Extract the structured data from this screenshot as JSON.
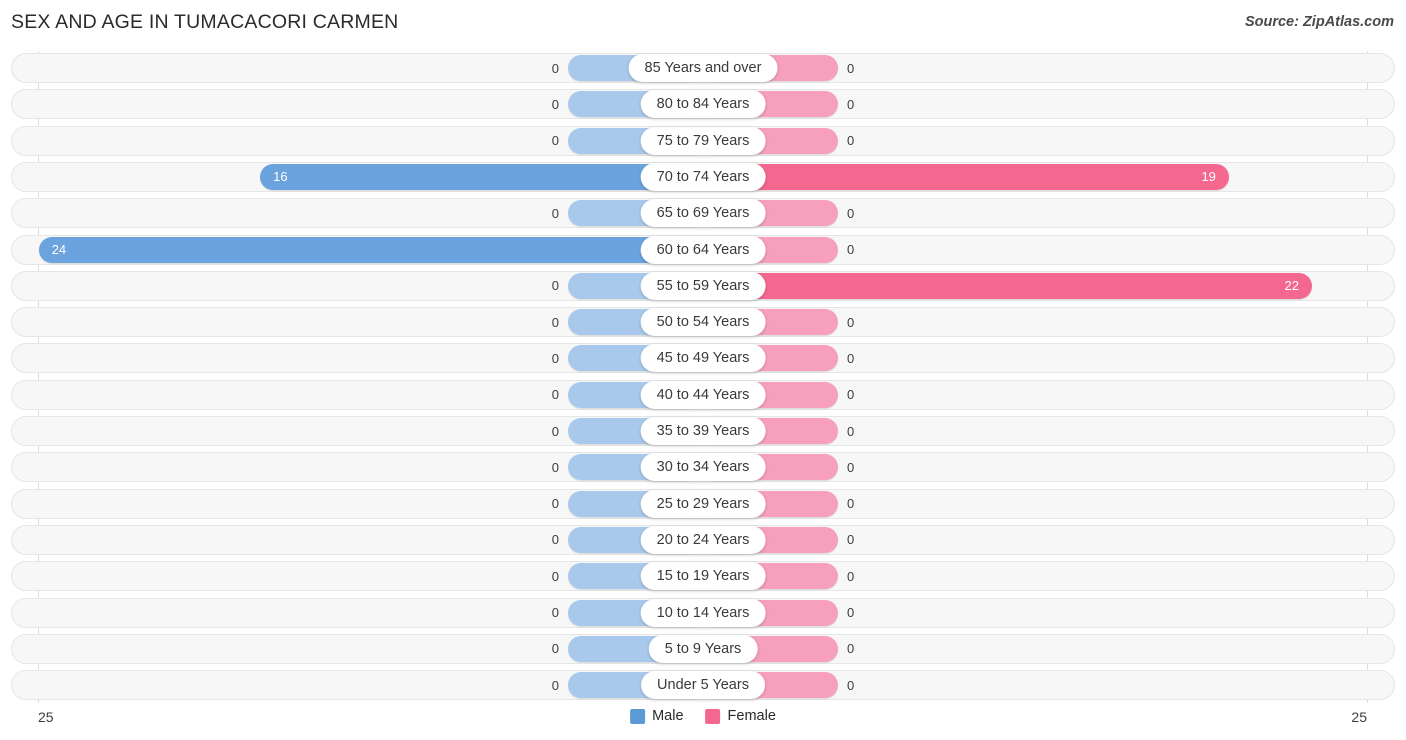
{
  "header": {
    "title": "SEX AND AGE IN TUMACACORI CARMEN",
    "source": "Source: ZipAtlas.com"
  },
  "legend": {
    "items": [
      {
        "label": "Male",
        "color": "#5b9bd5"
      },
      {
        "label": "Female",
        "color": "#f4688f"
      }
    ]
  },
  "axis": {
    "left_tick": "25",
    "right_tick": "25",
    "max": 25
  },
  "colors": {
    "male": "#6ba3de",
    "female": "#f4688f",
    "male_zero": "#a9c9ec",
    "female_zero": "#f7a0bd",
    "track": "#f7f7f7",
    "track_border": "#e6e6e6"
  },
  "chart_data": {
    "type": "bar",
    "title": "SEX AND AGE IN TUMACACORI CARMEN",
    "subtitle": "",
    "xlabel": "",
    "ylabel": "",
    "orientation": "horizontal-diverging",
    "legend_position": "bottom-center",
    "grid": false,
    "xlim": [
      25,
      25
    ],
    "categories": [
      "85 Years and over",
      "80 to 84 Years",
      "75 to 79 Years",
      "70 to 74 Years",
      "65 to 69 Years",
      "60 to 64 Years",
      "55 to 59 Years",
      "50 to 54 Years",
      "45 to 49 Years",
      "40 to 44 Years",
      "35 to 39 Years",
      "30 to 34 Years",
      "25 to 29 Years",
      "20 to 24 Years",
      "15 to 19 Years",
      "10 to 14 Years",
      "5 to 9 Years",
      "Under 5 Years"
    ],
    "series": [
      {
        "name": "Male",
        "color": "#6ba3de",
        "values": [
          0,
          0,
          0,
          16,
          0,
          24,
          0,
          0,
          0,
          0,
          0,
          0,
          0,
          0,
          0,
          0,
          0,
          0
        ]
      },
      {
        "name": "Female",
        "color": "#f4688f",
        "values": [
          0,
          0,
          0,
          19,
          0,
          0,
          22,
          0,
          0,
          0,
          0,
          0,
          0,
          0,
          0,
          0,
          0,
          0
        ]
      }
    ]
  },
  "rows": [
    {
      "label": "85 Years and over",
      "male": "0",
      "female": "0"
    },
    {
      "label": "80 to 84 Years",
      "male": "0",
      "female": "0"
    },
    {
      "label": "75 to 79 Years",
      "male": "0",
      "female": "0"
    },
    {
      "label": "70 to 74 Years",
      "male": "16",
      "female": "19"
    },
    {
      "label": "65 to 69 Years",
      "male": "0",
      "female": "0"
    },
    {
      "label": "60 to 64 Years",
      "male": "24",
      "female": "0"
    },
    {
      "label": "55 to 59 Years",
      "male": "0",
      "female": "22"
    },
    {
      "label": "50 to 54 Years",
      "male": "0",
      "female": "0"
    },
    {
      "label": "45 to 49 Years",
      "male": "0",
      "female": "0"
    },
    {
      "label": "40 to 44 Years",
      "male": "0",
      "female": "0"
    },
    {
      "label": "35 to 39 Years",
      "male": "0",
      "female": "0"
    },
    {
      "label": "30 to 34 Years",
      "male": "0",
      "female": "0"
    },
    {
      "label": "25 to 29 Years",
      "male": "0",
      "female": "0"
    },
    {
      "label": "20 to 24 Years",
      "male": "0",
      "female": "0"
    },
    {
      "label": "15 to 19 Years",
      "male": "0",
      "female": "0"
    },
    {
      "label": "10 to 14 Years",
      "male": "0",
      "female": "0"
    },
    {
      "label": "5 to 9 Years",
      "male": "0",
      "female": "0"
    },
    {
      "label": "Under 5 Years",
      "male": "0",
      "female": "0"
    }
  ]
}
